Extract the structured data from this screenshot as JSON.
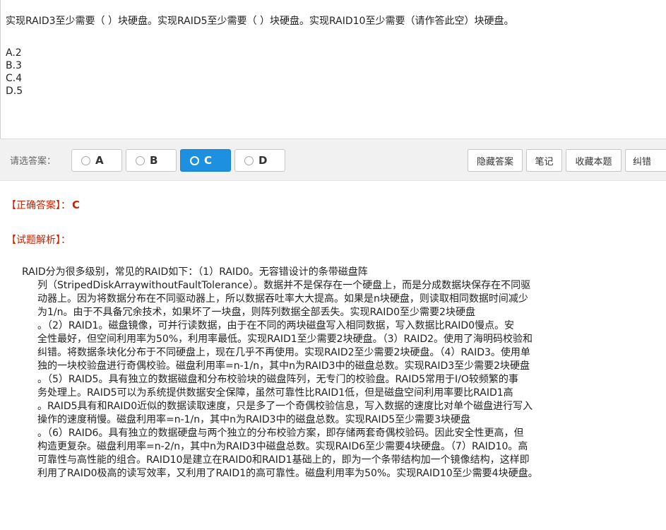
{
  "question": {
    "text": "实现RAID3至少需要（ ）块硬盘。实现RAID5至少需要（ ）块硬盘。实现RAID10至少需要（请作答此空）块硬盘。",
    "options": [
      "A.2",
      "B.3",
      "C.4",
      "D.5"
    ]
  },
  "answer_bar": {
    "label": "请选答案：",
    "choices": [
      {
        "letter": "A",
        "selected": false
      },
      {
        "letter": "B",
        "selected": false
      },
      {
        "letter": "C",
        "selected": true
      },
      {
        "letter": "D",
        "selected": false
      }
    ],
    "tools": {
      "hide_answer": "隐藏答案",
      "notes": "笔记",
      "favorite": "收藏本题",
      "report": "纠错"
    }
  },
  "result": {
    "correct_label": "【正确答案】：",
    "correct_value": "C",
    "analysis_label": "【试题解析】："
  },
  "analysis_lines": [
    "RAID分为很多级别，常见的RAID如下：（1）RAID0。无容错设计的条带磁盘阵",
    "列（StripedDiskArraywithoutFaultTolerance）。数据并不是保存在一个硬盘上，而是分成数据块保存在不同驱",
    "动器上。因为将数据分布在不同驱动器上，所以数据吞吐率大大提高。如果是n块硬盘，则读取相同数据时间减少",
    "为1/n。由于不具备冗余技术，如果坏了一块盘，则阵列数据全部丢失。实现RAID0至少需要2块硬盘",
    "。（2）RAID1。磁盘镜像，可并行读数据，由于在不同的两块磁盘写入相同数据，写入数据比RAID0慢点。安",
    "全性最好，但空间利用率为50%，利用率最低。实现RAID1至少需要2块硬盘。（3）RAID2。使用了海明码校验和",
    "纠错。将数据条块化分布于不同硬盘上，现在几乎不再使用。实现RAID2至少需要2块硬盘。（4）RAID3。使用单",
    "独的一块校验盘进行奇偶校验。磁盘利用率=n-1/n，其中n为RAID3中的磁盘总数。实现RAID3至少需要2块硬盘",
    "。（5）RAID5。具有独立的数据磁盘和分布校验块的磁盘阵列，无专门的校验盘。RAID5常用于I/O较频繁的事",
    "务处理上。RAID5可以为系统提供数据安全保障，虽然可靠性比RAID1低，但是磁盘空间利用率要比RAID1高",
    "。RAID5具有和RAID0近似的数据读取速度，只是多了一个奇偶校验信息，写入数据的速度比对单个磁盘进行写入",
    "操作的速度稍慢。磁盘利用率=n-1/n，其中n为RAID3中的磁盘总数。实现RAID5至少需要3块硬盘",
    "。（6）RAID6。具有独立的数据硬盘与两个独立的分布校验方案，即存储两套奇偶校验码。因此安全性更高，但",
    "构造更复杂。磁盘利用率=n-2/n，其中n为RAID3中磁盘总数。实现RAID6至少需要4块硬盘。（7）RAID10。高",
    "可靠性与高性能的组合。RAID10是建立在RAID0和RAID1基础上的，即为一个条带结构加一个镜像结构，这样即",
    "利用了RAID0极高的读写效率，又利用了RAID1的高可靠性。磁盘利用率为50%。实现RAID10至少需要4块硬盘。"
  ],
  "colors": {
    "accent": "#1e90e0",
    "answer_red": "#cc2200",
    "bar_bg": "#f1f1f1"
  }
}
